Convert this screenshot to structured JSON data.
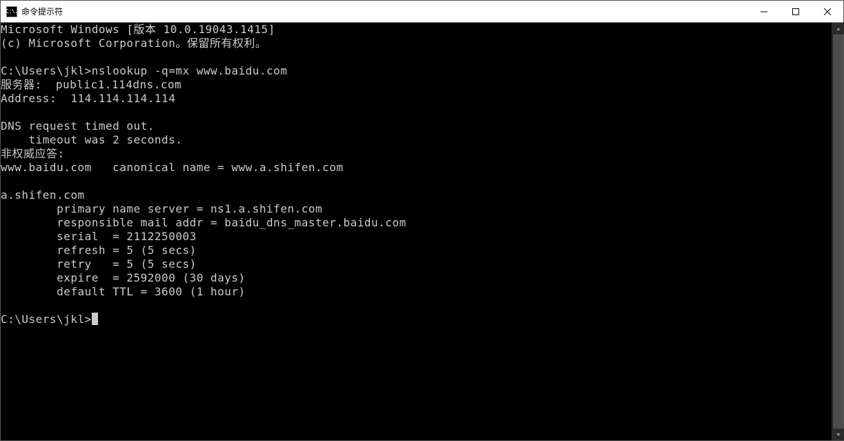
{
  "window": {
    "title": "命令提示符",
    "icon_label": "C:\\."
  },
  "terminal": {
    "lines": [
      "Microsoft Windows [版本 10.0.19043.1415]",
      "(c) Microsoft Corporation。保留所有权利。",
      "",
      "C:\\Users\\jkl>nslookup -q=mx www.baidu.com",
      "服务器:  public1.114dns.com",
      "Address:  114.114.114.114",
      "",
      "DNS request timed out.",
      "    timeout was 2 seconds.",
      "非权威应答:",
      "www.baidu.com   canonical name = www.a.shifen.com",
      "",
      "a.shifen.com",
      "        primary name server = ns1.a.shifen.com",
      "        responsible mail addr = baidu_dns_master.baidu.com",
      "        serial  = 2112250003",
      "        refresh = 5 (5 secs)",
      "        retry   = 5 (5 secs)",
      "        expire  = 2592000 (30 days)",
      "        default TTL = 3600 (1 hour)",
      "",
      "C:\\Users\\jkl>"
    ]
  }
}
